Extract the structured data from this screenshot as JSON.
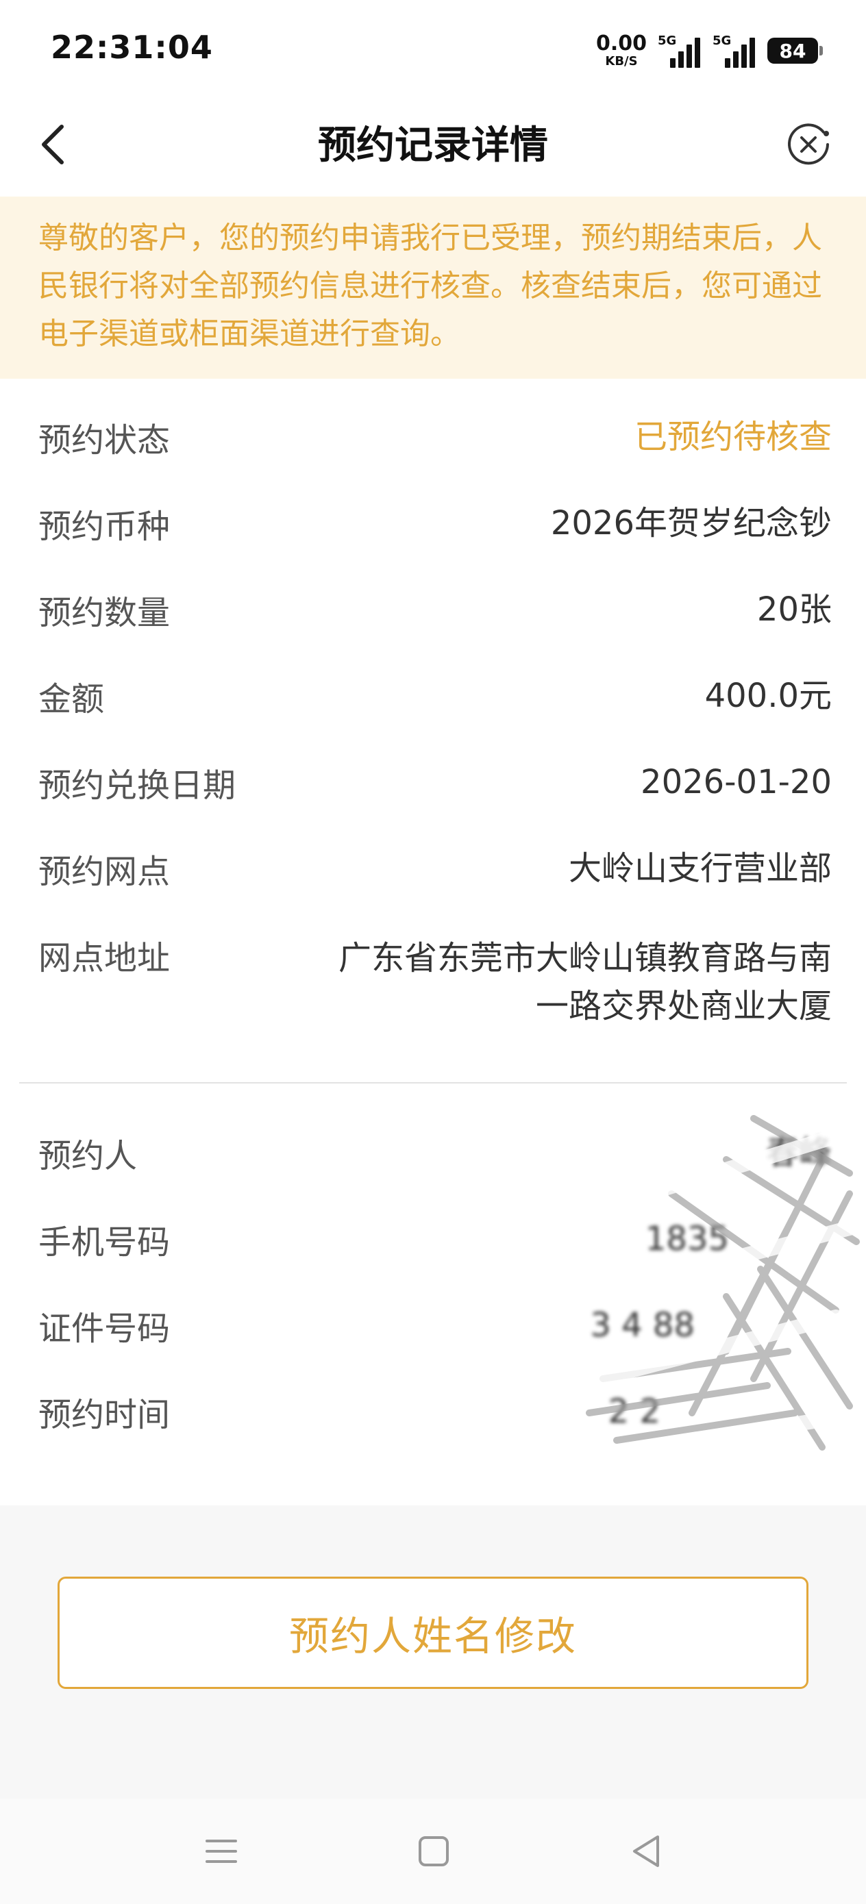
{
  "status_bar": {
    "time": "22:31:04",
    "net_speed_value": "0.00",
    "net_speed_unit": "KB/S",
    "signal_1_label": "5G",
    "signal_2_label": "5G",
    "battery_level": "84"
  },
  "header": {
    "title": "预约记录详情",
    "back_icon": "chevron-left-icon",
    "close_icon": "close-circle-icon"
  },
  "notice": {
    "text": "尊敬的客户，您的预约申请我行已受理，预约期结束后，人民银行将对全部预约信息进行核查。核查结束后，您可通过电子渠道或柜面渠道进行查询。"
  },
  "details": {
    "status": {
      "label": "预约状态",
      "value": "已预约待核查"
    },
    "currency": {
      "label": "预约币种",
      "value": "2026年贺岁纪念钞"
    },
    "quantity": {
      "label": "预约数量",
      "value": "20张"
    },
    "amount": {
      "label": "金额",
      "value": "400.0元"
    },
    "exchange_date": {
      "label": "预约兑换日期",
      "value": "2026-01-20"
    },
    "branch": {
      "label": "预约网点",
      "value": "大岭山支行营业部"
    },
    "address": {
      "label": "网点地址",
      "value": "广东省东莞市大岭山镇教育路与南一路交界处商业大厦"
    }
  },
  "personal": {
    "name": {
      "label": "预约人",
      "value": "春峰"
    },
    "phone": {
      "label": "手机号码",
      "value": "1835"
    },
    "id_number": {
      "label": "证件号码",
      "value": "3 4 88"
    },
    "time": {
      "label": "预约时间",
      "value": "2 2"
    }
  },
  "actions": {
    "modify_name": "预约人姓名修改"
  },
  "nav": {
    "menu_icon": "menu-icon",
    "home_icon": "square-home-icon",
    "back_icon": "triangle-back-icon"
  },
  "colors": {
    "accent": "#e2a73a",
    "notice_bg": "#fdf5e4",
    "page_bg": "#f7f7f7"
  }
}
